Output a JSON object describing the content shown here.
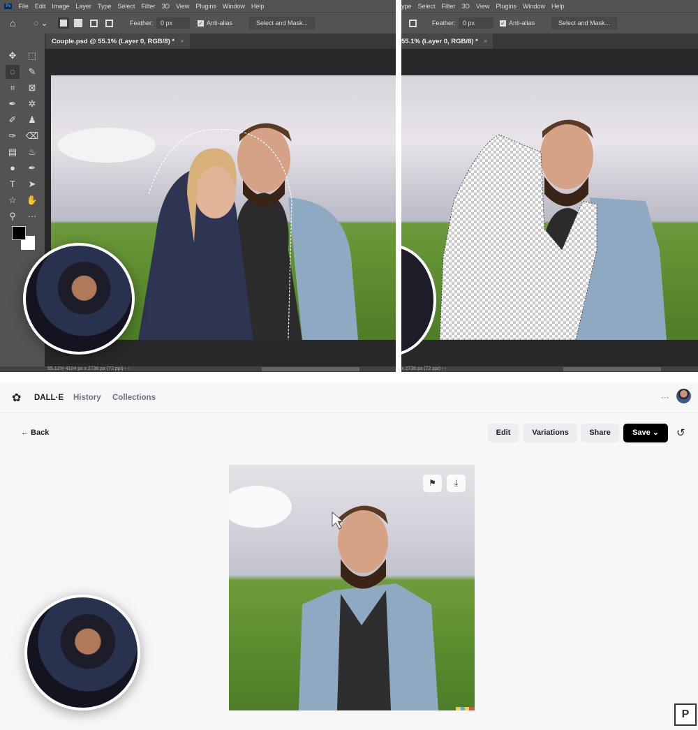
{
  "photoshop_left": {
    "menu": [
      "File",
      "Edit",
      "Image",
      "Layer",
      "Type",
      "Select",
      "Filter",
      "3D",
      "View",
      "Plugins",
      "Window",
      "Help"
    ],
    "feather_label": "Feather:",
    "feather_value": "0 px",
    "antialias_label": "Anti-alias",
    "antialias_checked": true,
    "select_mask_label": "Select and Mask...",
    "tab_title": "Couple.psd @ 55.1% (Layer 0, RGB/8) *",
    "tab_close": "×",
    "status": "55.12%   4104 px x 2736 px (72 ppi)   ›  ‹"
  },
  "photoshop_right": {
    "menu": [
      "ype",
      "Select",
      "Filter",
      "3D",
      "View",
      "Plugins",
      "Window",
      "Help"
    ],
    "feather_label": "Feather:",
    "feather_value": "0 px",
    "antialias_label": "Anti-alias",
    "select_mask_label": "Select and Mask...",
    "tab_title": "55.1% (Layer 0, RGB/8) *",
    "tab_close": "×",
    "status": "x 2736 px (72 ppi)   ›  ‹"
  },
  "dalle": {
    "brand": "DALL·E",
    "nav": [
      "History",
      "Collections"
    ],
    "more": "···",
    "back": "← Back",
    "actions": {
      "edit": "Edit",
      "variations": "Variations",
      "share": "Share",
      "save": "Save ⌄"
    },
    "colors": {
      "save_bg": "#000000",
      "button_bg": "#ececf1",
      "page_bg": "#f7f7f8"
    }
  }
}
